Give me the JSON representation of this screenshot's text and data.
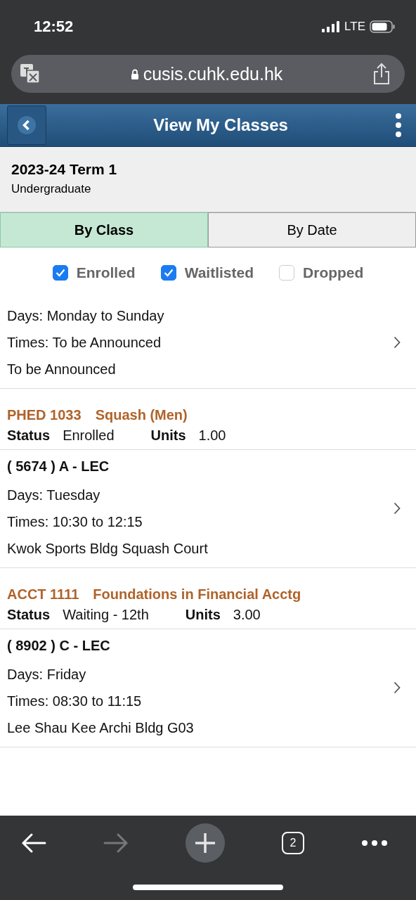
{
  "status_bar": {
    "time": "12:52",
    "network": "LTE"
  },
  "address_bar": {
    "url": "cusis.cuhk.edu.hk"
  },
  "header": {
    "title": "View My Classes"
  },
  "term": {
    "name": "2023-24 Term 1",
    "career": "Undergraduate"
  },
  "tabs": [
    {
      "label": "By Class",
      "selected": true
    },
    {
      "label": "By Date",
      "selected": false
    }
  ],
  "filters": [
    {
      "label": "Enrolled",
      "checked": true
    },
    {
      "label": "Waitlisted",
      "checked": true
    },
    {
      "label": "Dropped",
      "checked": false
    }
  ],
  "blocks": [
    {
      "kind": "meeting",
      "lines": [
        "Days: Monday to Sunday",
        "Times: To be Announced",
        "To be Announced"
      ]
    },
    {
      "kind": "course",
      "code": "PHED 1033",
      "title": "Squash (Men)",
      "status_label": "Status",
      "status": "Enrolled",
      "units_label": "Units",
      "units": "1.00"
    },
    {
      "kind": "section",
      "heading": "( 5674 ) A - LEC",
      "lines": [
        "Days: Tuesday",
        "Times: 10:30 to 12:15",
        "Kwok Sports Bldg Squash Court"
      ]
    },
    {
      "kind": "course",
      "code": "ACCT 1111",
      "title": "Foundations in Financial Acctg",
      "status_label": "Status",
      "status": "Waiting - 12th",
      "units_label": "Units",
      "units": "3.00"
    },
    {
      "kind": "section",
      "heading": "( 8902 ) C - LEC",
      "lines": [
        "Days: Friday",
        "Times: 08:30 to 11:15",
        "Lee Shau Kee Archi Bldg G03"
      ]
    }
  ],
  "toolbar": {
    "tab_count": "2"
  }
}
